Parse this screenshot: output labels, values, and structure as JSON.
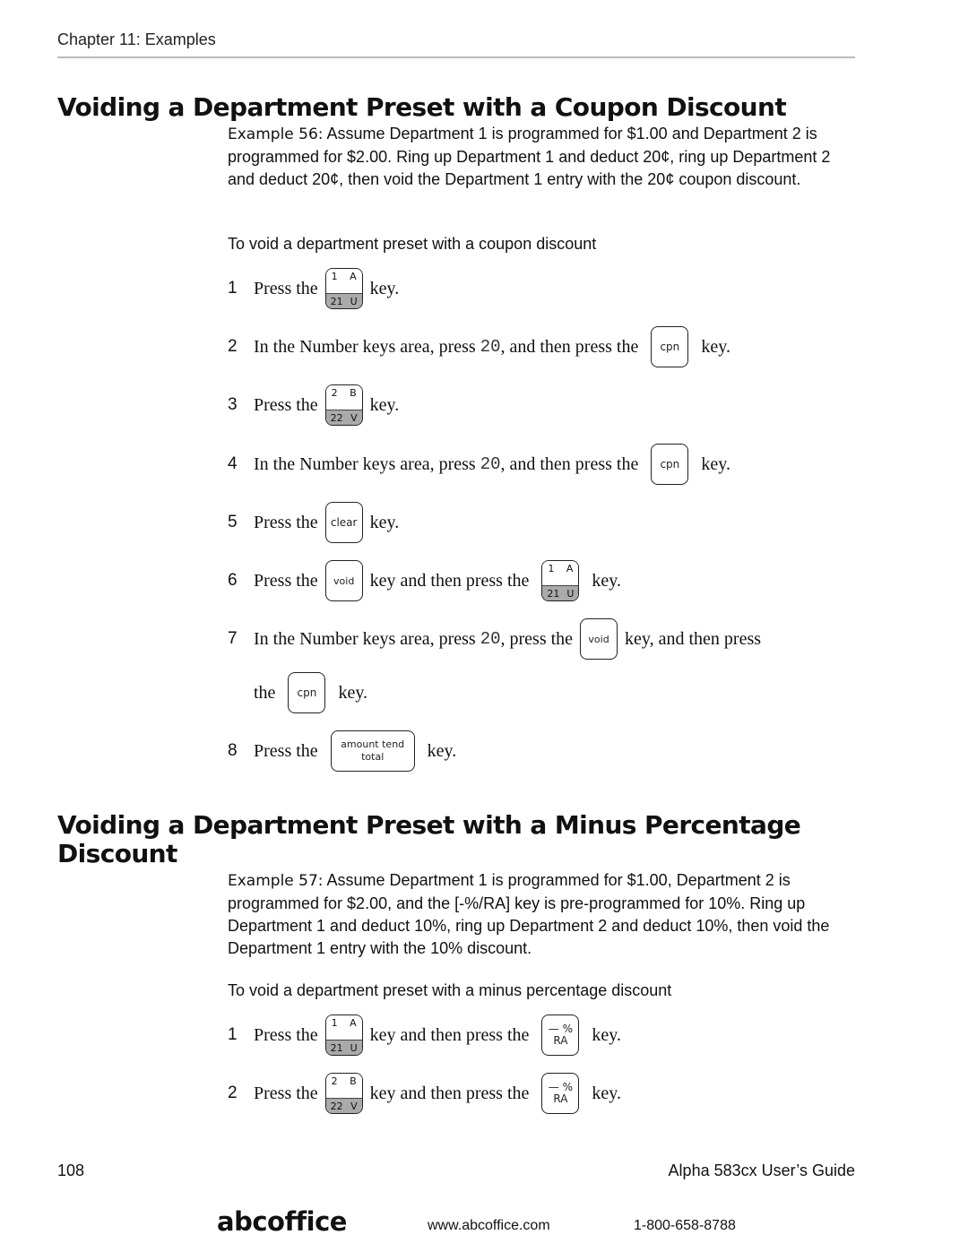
{
  "header": {
    "chapter": "Chapter 11:  Examples"
  },
  "section1": {
    "title": "Voiding a Department Preset with a Coupon Discount",
    "example_label": "Example 56:",
    "example_text": " Assume Department 1 is programmed for $1.00 and Department 2 is programmed for $2.00. Ring up Department 1 and deduct 20¢, ring up Department 2 and deduct 20¢, then void the Department 1 entry with the 20¢ coupon discount.",
    "procedure_title": "To void a department preset with a coupon discount",
    "steps": [
      {
        "num": "1",
        "pre": "Press the",
        "post": "key."
      },
      {
        "num": "2",
        "pre": "In the Number keys area, press",
        "value": "20",
        "mid": ", and then press the",
        "post": "key."
      },
      {
        "num": "3",
        "pre": "Press the",
        "post": "key."
      },
      {
        "num": "4",
        "pre": "In the Number keys area, press",
        "value": "20",
        "mid": ", and then press the",
        "post": "key."
      },
      {
        "num": "5",
        "pre": "Press the",
        "post": "key."
      },
      {
        "num": "6",
        "pre": "Press the",
        "mid": "key and then press the",
        "post": "key."
      },
      {
        "num": "7",
        "pre": "In the Number keys area, press",
        "value": "20",
        "mid": ", press the",
        "post": "key, and then press",
        "cont_pre": "the",
        "cont_post": "key."
      },
      {
        "num": "8",
        "pre": "Press the",
        "post": "key."
      }
    ]
  },
  "section2": {
    "title_line1": "Voiding a Department Preset with a Minus Percentage",
    "title_line2": "Discount",
    "example_label": "Example 57:",
    "example_text": " Assume Department 1 is programmed for $1.00, Department 2 is programmed for $2.00, and the [-%/RA] key is pre-programmed for 10%. Ring up Department 1 and deduct 10%, ring up Department 2 and deduct 10%, then void the Department 1 entry with the 10% discount.",
    "procedure_title": "To void a department preset with a minus percentage discount",
    "steps": [
      {
        "num": "1",
        "pre": "Press the",
        "mid": "key and then press the",
        "post": "key."
      },
      {
        "num": "2",
        "pre": "Press the",
        "mid": "key and then press the",
        "post": "key."
      }
    ]
  },
  "keys": {
    "dept1": {
      "tl": "1",
      "tr": "A",
      "bl": "21",
      "br": "U"
    },
    "dept2": {
      "tl": "2",
      "tr": "B",
      "bl": "22",
      "br": "V"
    },
    "cpn": "cpn",
    "clear": "clear",
    "void": "void",
    "amount_tend_line1": "amount tend",
    "amount_tend_line2": "total",
    "minus_pct_top": "— %",
    "minus_pct_bottom": "RA"
  },
  "footer": {
    "page_number": "108",
    "guide_title": "Alpha 583cx  User’s Guide",
    "logo": "abcoffice",
    "website": "www.abcoffice.com",
    "phone": "1-800-658-8788"
  }
}
